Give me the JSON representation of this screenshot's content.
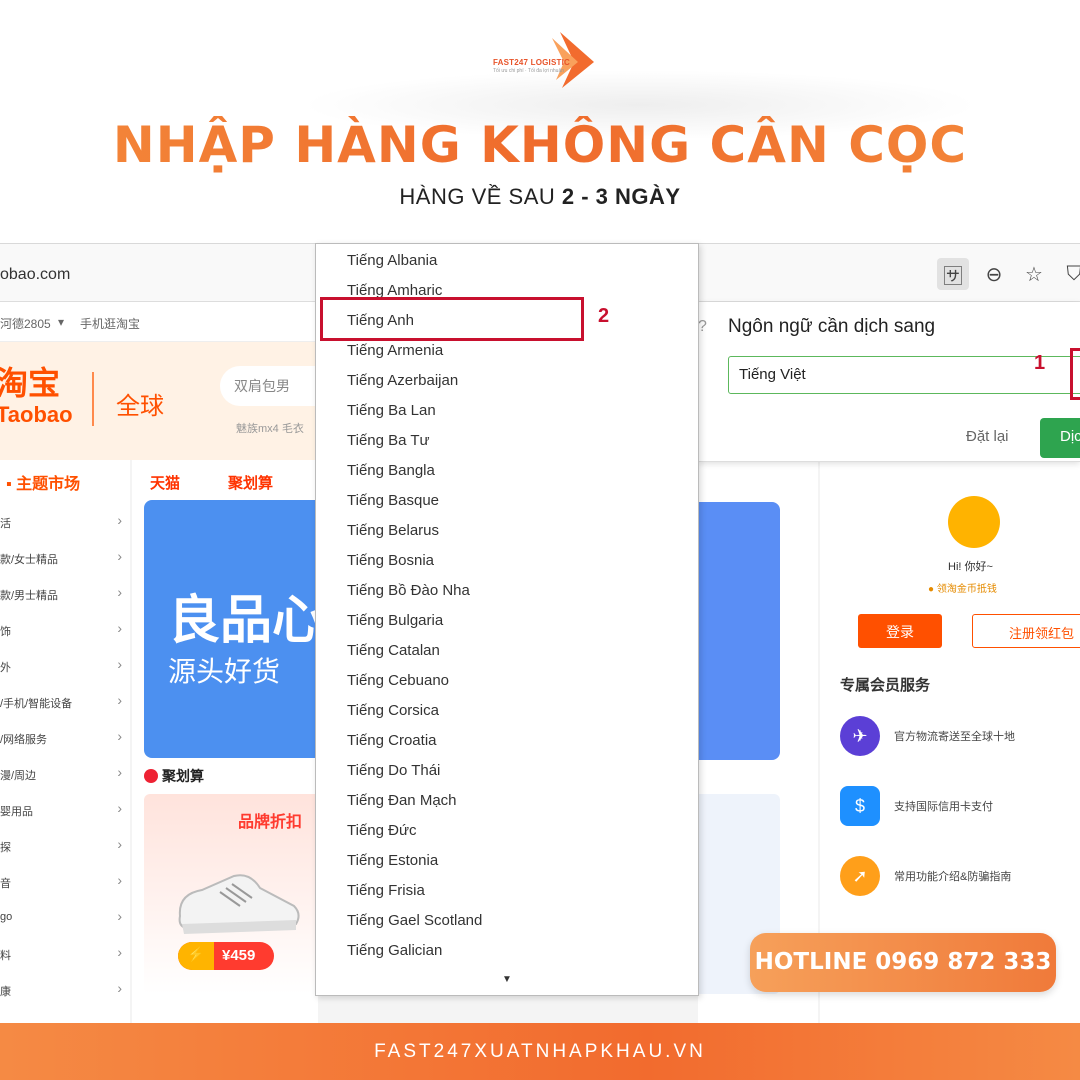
{
  "brand": {
    "logo_text": "FAST247 LOGISTIC",
    "logo_tagline": "Tối ưu chi phí · Tối đa lợi nhuận",
    "accent": "#f26b2e"
  },
  "promo": {
    "headline": "NHẬP HÀNG KHÔNG CẦN CỌC",
    "sub_prefix": "HÀNG VỀ SAU ",
    "sub_bold": "2 - 3 NGÀY"
  },
  "browser": {
    "url": "obao.com",
    "toolbar_icons": [
      "translate-icon",
      "zoom-out-icon",
      "star-icon",
      "shield-icon"
    ]
  },
  "taobao": {
    "topnav": [
      "河德2805",
      "手机逛淘宝"
    ],
    "logo_cn": "淘宝",
    "logo_en": "Taobao",
    "global": "全球",
    "search_placeholder": "双肩包男",
    "search_hint": "魅族mx4 毛衣",
    "sidebar_title": "主题市场",
    "sidebar_items": [
      "活",
      "款/女士精品",
      "款/男士精品",
      "饰",
      "外",
      "/手机/智能设备",
      "/网络服务",
      "漫/周边",
      "婴用品",
      "探",
      "音",
      "go",
      "料",
      "康"
    ],
    "tabs": [
      "天猫",
      "聚划算"
    ],
    "banner_big": "良品心",
    "banner_small": "源头好货",
    "jhs_title": "聚划算",
    "promo_title": "品牌折扣",
    "price": "¥459",
    "greeting": "Hi! 你好~",
    "coin_text": "领淘金币抵钱",
    "login": "登录",
    "register": "注册领红包",
    "vip_title": "专属会员服务",
    "services": [
      {
        "icon": "plane-icon",
        "text": "官方物流寄送至全球十地"
      },
      {
        "icon": "wallet-icon",
        "text": "支持国际信用卡支付"
      },
      {
        "icon": "compass-icon",
        "text": "常用功能介绍&防骗指南"
      }
    ]
  },
  "translate_popup": {
    "title": "Ngôn ngữ cần dịch sang",
    "selected_language": "Tiếng Việt",
    "reset_label": "Đặt lại",
    "translate_label": "Dịch"
  },
  "annotations": {
    "step1": "1",
    "step2": "2"
  },
  "languages": [
    "Tiếng Albania",
    "Tiếng Amharic",
    "Tiếng Anh",
    "Tiếng Armenia",
    "Tiếng Azerbaijan",
    "Tiếng Ba Lan",
    "Tiếng Ba Tư",
    "Tiếng Bangla",
    "Tiếng Basque",
    "Tiếng Belarus",
    "Tiếng Bosnia",
    "Tiếng Bồ Đào Nha",
    "Tiếng Bulgaria",
    "Tiếng Catalan",
    "Tiếng Cebuano",
    "Tiếng Corsica",
    "Tiếng Croatia",
    "Tiếng Do Thái",
    "Tiếng Đan Mạch",
    "Tiếng Đức",
    "Tiếng Estonia",
    "Tiếng Frisia",
    "Tiếng Gael Scotland",
    "Tiếng Galician"
  ],
  "hotline": "HOTLINE 0969 872 333",
  "footer": "FAST247XUATNHAPKHAU.VN"
}
